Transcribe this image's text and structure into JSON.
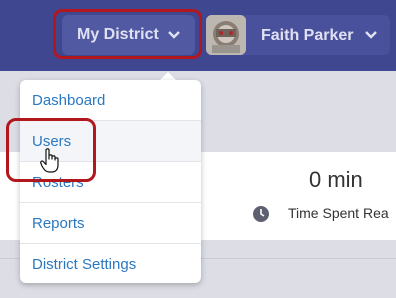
{
  "header": {
    "district_label": "My District",
    "user_name": "Faith Parker"
  },
  "menu": {
    "items": [
      {
        "label": "Dashboard"
      },
      {
        "label": "Users"
      },
      {
        "label": "Rosters"
      },
      {
        "label": "Reports"
      },
      {
        "label": "District Settings"
      }
    ]
  },
  "stat": {
    "value": "0 min",
    "label": "Time Spent Rea"
  },
  "colors": {
    "header_bg": "#3f4790",
    "link": "#2a78c2",
    "highlight": "#b3171e"
  },
  "icons": [
    "chevron-down-icon",
    "clock-icon",
    "hand-pointer-icon"
  ]
}
